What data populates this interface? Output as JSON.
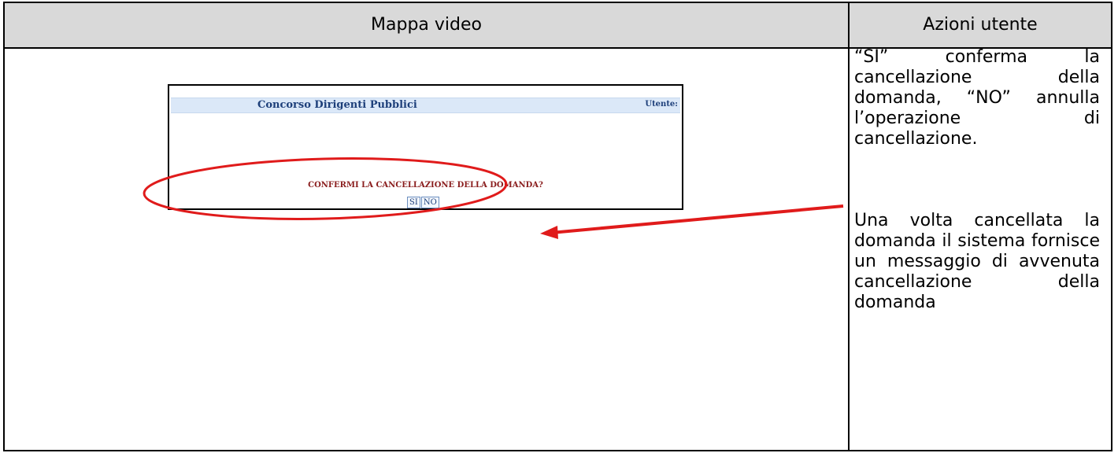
{
  "table": {
    "header_left": "Mappa video",
    "header_right": "Azioni utente"
  },
  "actions": {
    "paragraph_1": "“SI” conferma la cancellazione della domanda, “NO” annulla l’operazione di cancellazione.",
    "paragraph_2": "Una volta cancellata la domanda il sistema fornisce un messaggio di avvenuta cancellazione della domanda"
  },
  "screenshot": {
    "title": "Concorso Dirigenti Pubblici",
    "user_label": "Utente:",
    "question": "CONFERMI LA CANCELLAZIONE DELLA DOMANDA?",
    "yes_button": "SI",
    "no_button": "NO"
  },
  "colors": {
    "annotation": "#e01b1b",
    "header_bg": "#d9d9d9",
    "screenshot_header_bg": "#dbe8f8",
    "question_text": "#8a1d1d"
  }
}
